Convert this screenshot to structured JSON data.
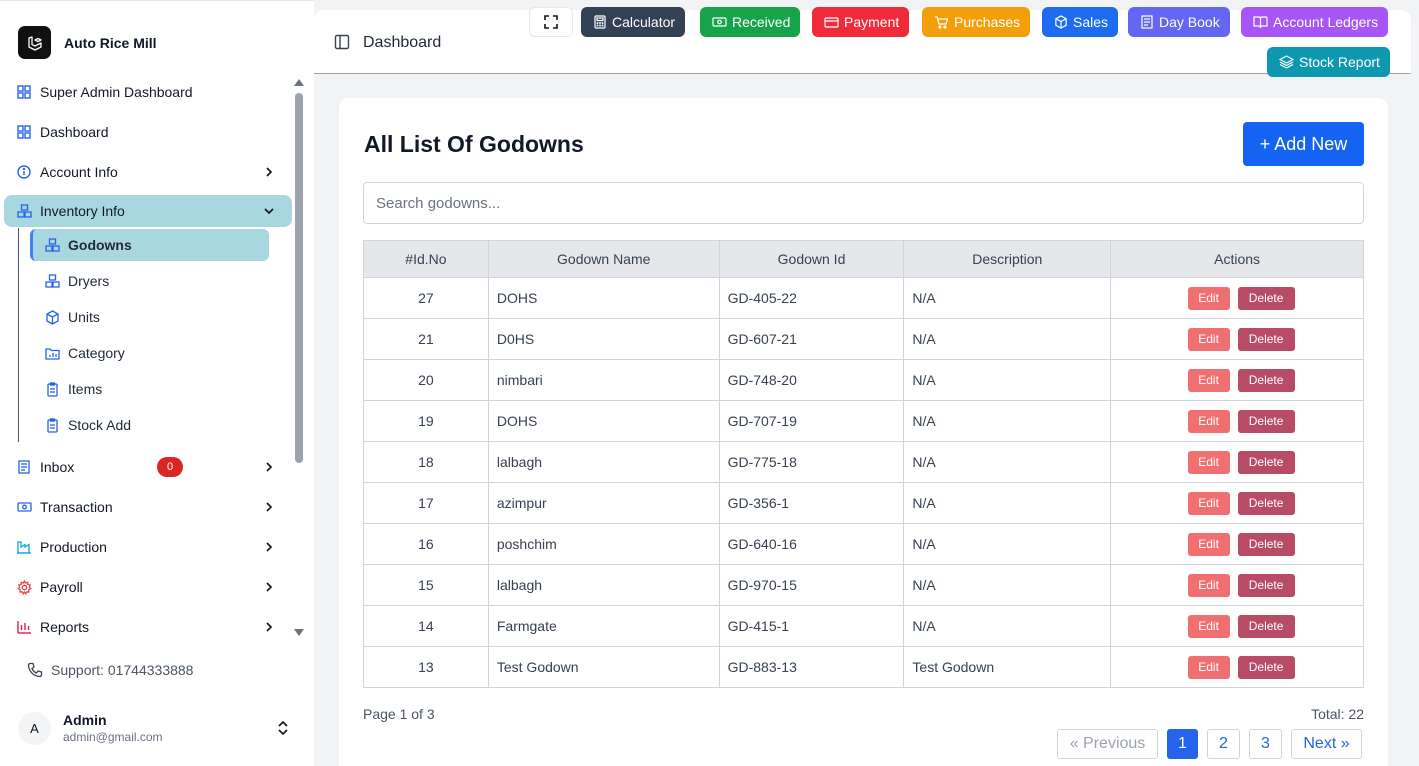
{
  "brand": {
    "name": "Auto Rice Mill"
  },
  "sidebar": {
    "items": [
      {
        "label": "Super Admin Dashboard",
        "icon": "grid-icon"
      },
      {
        "label": "Dashboard",
        "icon": "grid-icon"
      },
      {
        "label": "Account Info",
        "icon": "info-icon"
      },
      {
        "label": "Inventory Info",
        "icon": "boxes-icon"
      },
      {
        "label": "Inbox",
        "icon": "document-icon",
        "badge": "0"
      },
      {
        "label": "Transaction",
        "icon": "banknote-icon"
      },
      {
        "label": "Production",
        "icon": "factory-icon"
      },
      {
        "label": "Payroll",
        "icon": "gear-icon"
      },
      {
        "label": "Reports",
        "icon": "chart-icon"
      }
    ],
    "subitems": [
      {
        "label": "Godowns",
        "icon": "boxes-icon"
      },
      {
        "label": "Dryers",
        "icon": "boxes-icon"
      },
      {
        "label": "Units",
        "icon": "cube-icon"
      },
      {
        "label": "Category",
        "icon": "folder-chart-icon"
      },
      {
        "label": "Items",
        "icon": "clipboard-icon"
      },
      {
        "label": "Stock Add",
        "icon": "clipboard-icon"
      }
    ],
    "support": "Support: 01744333888",
    "user": {
      "name": "Admin",
      "email": "admin@gmail.com",
      "initial": "A"
    }
  },
  "header": {
    "title": "Dashboard",
    "quick_buttons": [
      {
        "label": "Calculator",
        "color": "#334155"
      },
      {
        "label": "Received",
        "color": "#16a34a"
      },
      {
        "label": "Payment",
        "color": "#ef2b3b"
      },
      {
        "label": "Purchases",
        "color": "#f59e0b"
      },
      {
        "label": "Sales",
        "color": "#1d6cf0"
      },
      {
        "label": "Day Book",
        "color": "#6366f1"
      },
      {
        "label": "Account Ledgers",
        "color": "#a855f7"
      },
      {
        "label": "Stock Report",
        "color": "#0e98b0"
      }
    ]
  },
  "main": {
    "title": "All List Of Godowns",
    "add_label": "+ Add New",
    "search_placeholder": "Search godowns...",
    "columns": [
      "#Id.No",
      "Godown Name",
      "Godown Id",
      "Description",
      "Actions"
    ],
    "rows": [
      {
        "id": "27",
        "name": "DOHS",
        "code": "GD-405-22",
        "desc": "N/A"
      },
      {
        "id": "21",
        "name": "D0HS",
        "code": "GD-607-21",
        "desc": "N/A"
      },
      {
        "id": "20",
        "name": "nimbari",
        "code": "GD-748-20",
        "desc": "N/A"
      },
      {
        "id": "19",
        "name": "DOHS",
        "code": "GD-707-19",
        "desc": "N/A"
      },
      {
        "id": "18",
        "name": "lalbagh",
        "code": "GD-775-18",
        "desc": "N/A"
      },
      {
        "id": "17",
        "name": "azimpur",
        "code": "GD-356-1",
        "desc": "N/A"
      },
      {
        "id": "16",
        "name": "poshchim",
        "code": "GD-640-16",
        "desc": "N/A"
      },
      {
        "id": "15",
        "name": "lalbagh",
        "code": "GD-970-15",
        "desc": "N/A"
      },
      {
        "id": "14",
        "name": "Farmgate",
        "code": "GD-415-1",
        "desc": "N/A"
      },
      {
        "id": "13",
        "name": "Test Godown",
        "code": "GD-883-13",
        "desc": "Test Godown"
      }
    ],
    "edit_label": "Edit",
    "delete_label": "Delete",
    "page_info": "Page 1 of 3",
    "total": "Total: 22",
    "pagination": {
      "prev": "« Previous",
      "pages": [
        "1",
        "2",
        "3"
      ],
      "next": "Next »"
    }
  }
}
